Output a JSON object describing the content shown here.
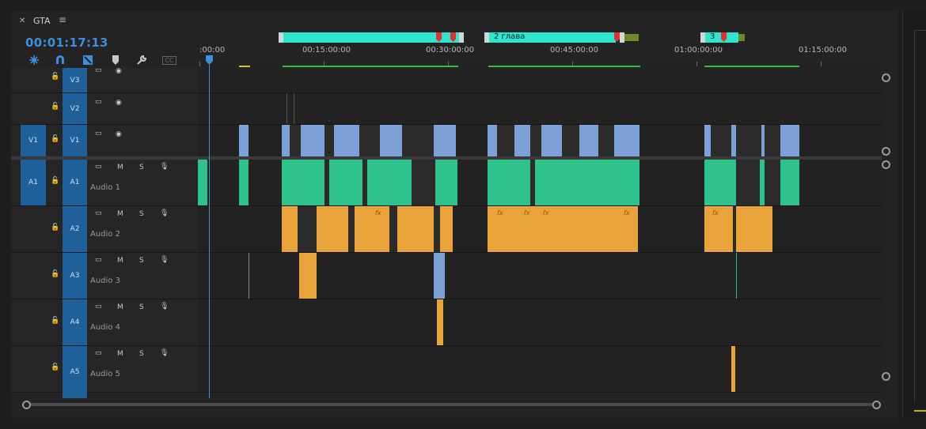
{
  "sequence": {
    "title": "GTA",
    "timecode": "00:01:17:13"
  },
  "ruler": {
    "labels": [
      ":00:00",
      "00:15:00:00",
      "00:30:00:00",
      "00:45:00:00",
      "01:00:00:00",
      "01:15:00:00"
    ]
  },
  "chapters": [
    {
      "label": ""
    },
    {
      "label": "2 глава"
    },
    {
      "label": "3 глава"
    }
  ],
  "tracks": {
    "v3": {
      "target": "V3"
    },
    "v2": {
      "target": "V2"
    },
    "v1": {
      "source": "V1",
      "target": "V1"
    },
    "a1": {
      "source": "A1",
      "target": "A1",
      "name": "Audio 1"
    },
    "a2": {
      "target": "A2",
      "name": "Audio 2"
    },
    "a3": {
      "target": "A3",
      "name": "Audio 3"
    },
    "a4": {
      "target": "A4",
      "name": "Audio 4"
    },
    "a5": {
      "target": "A5",
      "name": "Audio 5"
    }
  },
  "icons": {
    "mute": "M",
    "solo": "S",
    "captions": "CC"
  },
  "colors": {
    "accent": "#3c8fdd",
    "video_clip": "#7da0d6",
    "audio_clip": "#2fc28c",
    "adjusted_audio": "#e8a43a",
    "chapter": "#2ee6d0"
  }
}
